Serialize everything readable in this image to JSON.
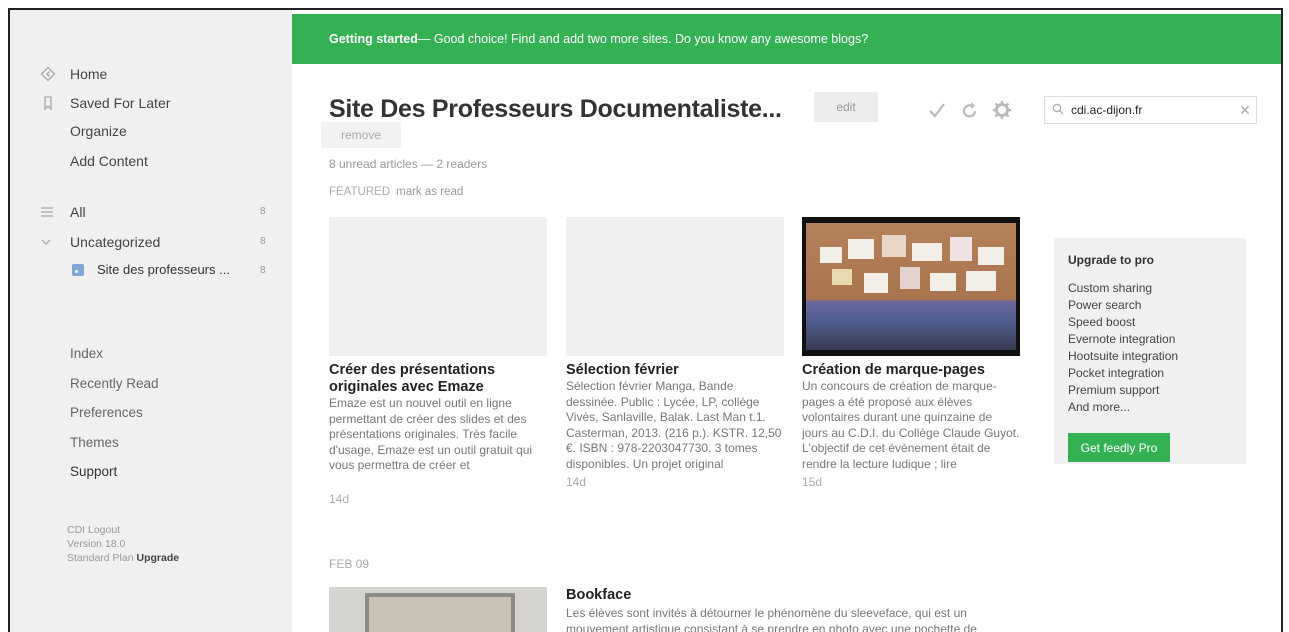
{
  "sidebar": {
    "nav": [
      {
        "label": "Home",
        "icon": "home-icon"
      },
      {
        "label": "Saved For Later",
        "icon": "bookmark-icon"
      },
      {
        "label": "Organize"
      },
      {
        "label": "Add Content"
      }
    ],
    "all": {
      "label": "All",
      "count": "8"
    },
    "uncategorized": {
      "label": "Uncategorized",
      "count": "8"
    },
    "feed": {
      "label": "Site des professeurs ...",
      "count": "8"
    },
    "lower": [
      "Index",
      "Recently Read",
      "Preferences",
      "Themes",
      "Support"
    ],
    "meta": {
      "logout": "CDI Logout",
      "version": "Version 18.0",
      "plan": "Standard Plan",
      "upgrade": "Upgrade"
    }
  },
  "banner": {
    "bold": "Getting started",
    "text": " — Good choice! Find and add two more sites. Do you know any awesome blogs?"
  },
  "header": {
    "title": "Site Des Professeurs Documentaliste...",
    "edit": "edit",
    "remove": "remove",
    "subinfo": "8 unread articles — 2 readers",
    "featured": "FEATURED",
    "mark_read": "mark as read"
  },
  "search": {
    "value": "cdi.ac-dijon.fr"
  },
  "cards": [
    {
      "title": "Créer des présentations originales avec Emaze",
      "excerpt": "Emaze est un nouvel outil en ligne permettant de créer des slides et des présentations originales. Très facile d'usage, Emaze est un outil gratuit qui vous permettra de créer et",
      "age": "14d"
    },
    {
      "title": "Sélection février",
      "excerpt": "Sélection février Manga, Bande dessinée. Public : Lycée, LP, collège Vivès, Sanlaville, Balak. Last Man t.1. Casterman, 2013. (216 p.). KSTR. 12,50 €. ISBN : 978-2203047730. 3 tomes disponibles. Un projet original",
      "age": "14d"
    },
    {
      "title": "Création de marque-pages",
      "excerpt": "Un concours de création de marque-pages a été proposé aux élèves volontaires durant une quinzaine de jours au C.D.I. du Collège Claude Guyot. L'objectif de cet évènement était de rendre la lecture ludique ; lire",
      "age": "15d"
    }
  ],
  "upgrade": {
    "title": "Upgrade to pro",
    "features": [
      "Custom sharing",
      "Power search",
      "Speed boost",
      "Evernote integration",
      "Hootsuite integration",
      "Pocket integration",
      "Premium support",
      "And more..."
    ],
    "button": "Get feedly Pro"
  },
  "feb": {
    "date": "FEB 09",
    "title": "Bookface",
    "excerpt": "Les élèves sont invités à détourner le phénomène du sleeveface, qui est un mouvement artistique consistant à se prendre en photo avec une pochette de"
  }
}
